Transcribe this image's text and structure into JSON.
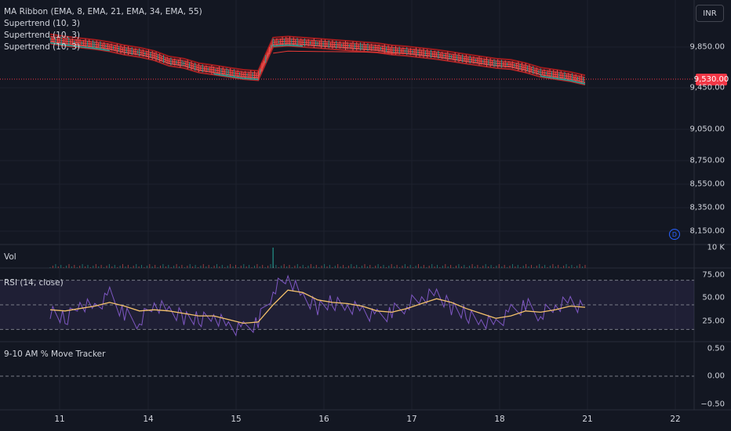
{
  "chart_data": [
    {
      "type": "line",
      "pane": "price",
      "legend": [
        "MA Ribbon (EMA, 8, EMA, 21, EMA, 34, EMA, 55)",
        "Supertrend (10, 3)",
        "Supertrend (10, 3)",
        "Supertrend (10, 3)"
      ],
      "currency": "INR",
      "y_ticks": [
        "9,850.00",
        "9,450.00",
        "9,050.00",
        "8,750.00",
        "8,550.00",
        "8,350.00",
        "8,150.00"
      ],
      "last_price": "9,530.00",
      "x_ticks": [
        "11",
        "14",
        "15",
        "16",
        "17",
        "18",
        "21",
        "22"
      ],
      "x": [
        0,
        1,
        2,
        3,
        4,
        5,
        6,
        7,
        8,
        9,
        10,
        11,
        12,
        13,
        14,
        15,
        16,
        17,
        18,
        19,
        20,
        21,
        22,
        23,
        24,
        25,
        26,
        27,
        28,
        29,
        30,
        31,
        32,
        33,
        34,
        35,
        36
      ],
      "values": [
        9900,
        9880,
        9865,
        9850,
        9830,
        9800,
        9780,
        9750,
        9700,
        9680,
        9640,
        9620,
        9600,
        9580,
        9570,
        9870,
        9880,
        9870,
        9860,
        9850,
        9840,
        9830,
        9820,
        9800,
        9790,
        9775,
        9760,
        9740,
        9720,
        9700,
        9680,
        9670,
        9640,
        9600,
        9580,
        9560,
        9530
      ],
      "ylim": [
        8050,
        10250
      ],
      "grid": true
    },
    {
      "type": "bar",
      "pane": "volume",
      "label": "Vol",
      "y_ticks": [
        "10 K"
      ]
    },
    {
      "type": "line",
      "pane": "rsi",
      "label": "RSI (14, close)",
      "y_ticks": [
        "75.00",
        "50.00",
        "25.00"
      ],
      "bands": [
        70,
        50,
        30
      ],
      "series": [
        {
          "values": [
            45,
            38,
            52,
            48,
            58,
            42,
            36,
            50,
            44,
            40,
            38,
            42,
            33,
            30,
            36,
            62,
            72,
            55,
            48,
            52,
            50,
            46,
            40,
            44,
            50,
            55,
            58,
            48,
            42,
            38,
            35,
            44,
            50,
            42,
            48,
            52,
            45
          ]
        },
        {
          "values": [
            46,
            45,
            47,
            49,
            52,
            49,
            45,
            46,
            45,
            43,
            41,
            41,
            38,
            35,
            36,
            50,
            62,
            60,
            54,
            52,
            51,
            49,
            45,
            44,
            47,
            51,
            55,
            52,
            47,
            43,
            39,
            41,
            45,
            44,
            46,
            49,
            48
          ]
        }
      ],
      "ylim": [
        20,
        80
      ]
    },
    {
      "type": "line",
      "pane": "tracker",
      "label": "9-10 AM % Move Tracker",
      "y_ticks": [
        "0.50",
        "0.00",
        "−0.50"
      ],
      "values": [
        0,
        0
      ],
      "ylim": [
        -0.5,
        0.5
      ]
    }
  ],
  "ui": {
    "scroll_button_label": "D"
  }
}
